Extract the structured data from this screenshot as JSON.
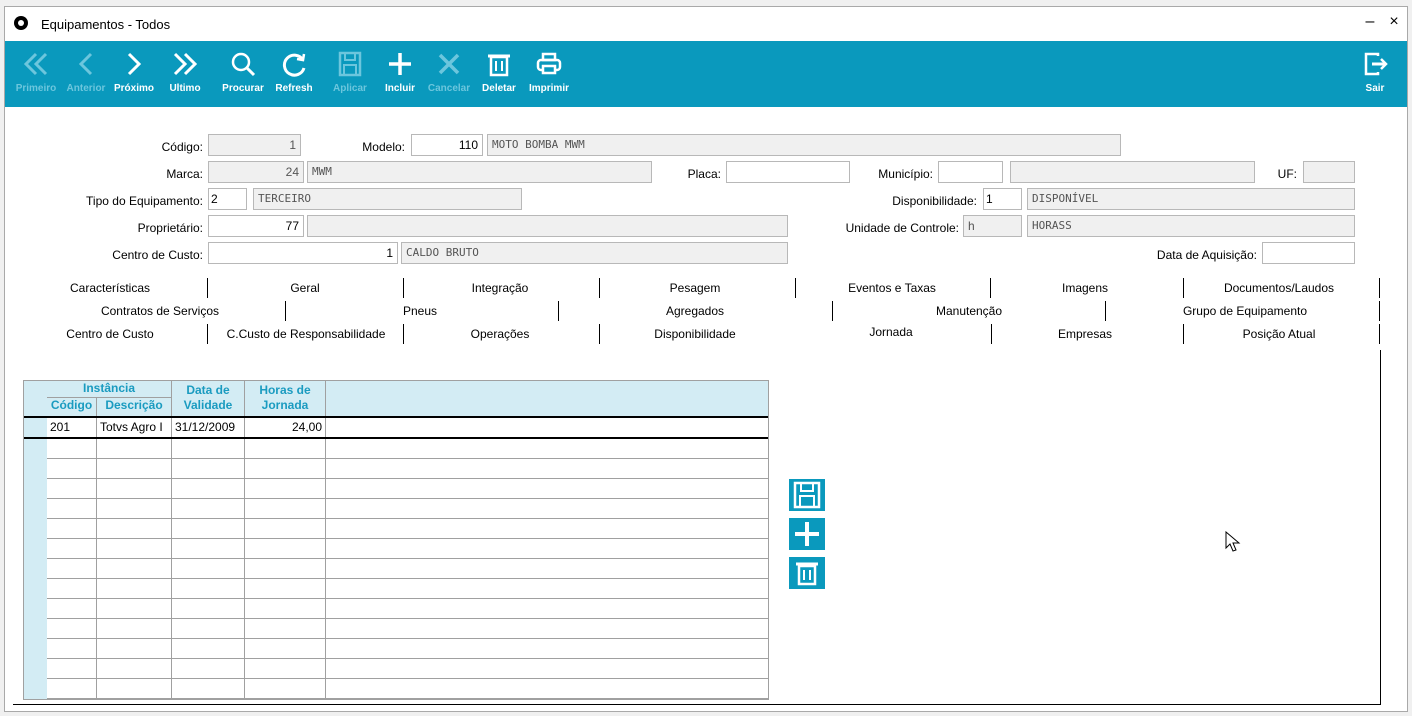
{
  "window": {
    "title": "Equipamentos - Todos",
    "minimize": "–",
    "close": "×"
  },
  "toolbar": {
    "primeiro": "Primeiro",
    "anterior": "Anterior",
    "proximo": "Próximo",
    "ultimo": "Ultimo",
    "procurar": "Procurar",
    "refresh": "Refresh",
    "aplicar": "Aplicar",
    "incluir": "Incluir",
    "cancelar": "Cancelar",
    "deletar": "Deletar",
    "imprimir": "Imprimir",
    "sair": "Sair"
  },
  "form": {
    "codigo_label": "Código:",
    "codigo": "1",
    "modelo_label": "Modelo:",
    "modelo_code": "110",
    "modelo_desc": "MOTO BOMBA MWM",
    "marca_label": "Marca:",
    "marca_code": "24",
    "marca_desc": "MWM",
    "placa_label": "Placa:",
    "placa": "",
    "municipio_label": "Município:",
    "municipio_code": "",
    "municipio_desc": "",
    "uf_label": "UF:",
    "uf": "",
    "tipo_label": "Tipo do Equipamento:",
    "tipo_code": "2",
    "tipo_desc": "TERCEIRO",
    "disp_label": "Disponibilidade:",
    "disp_code": "1",
    "disp_desc": "DISPONÍVEL",
    "prop_label": "Proprietário:",
    "prop_code": "77",
    "prop_desc": "",
    "unid_label": "Unidade de Controle:",
    "unid_code": "h",
    "unid_desc": "HORASS",
    "cc_label": "Centro de Custo:",
    "cc_code": "1",
    "cc_desc": "CALDO BRUTO",
    "aquis_label": "Data de Aquisição:",
    "aquis": ""
  },
  "tabs": {
    "row1": [
      "Características",
      "Geral",
      "Integração",
      "Pesagem",
      "Eventos e Taxas",
      "Imagens",
      "Documentos/Laudos"
    ],
    "row2": [
      "Contratos de Serviços",
      "Pneus",
      "Agregados",
      "Manutenção",
      "Grupo de Equipamento"
    ],
    "row3": [
      "Centro de Custo",
      "C.Custo de Responsabilidade",
      "Operações",
      "Disponibilidade",
      "Jornada",
      "Empresas",
      "Posição Atual"
    ],
    "active": "Jornada"
  },
  "grid": {
    "group_instancia": "Instância",
    "col_codigo": "Código",
    "col_descricao": "Descrição",
    "col_data_1": "Data de",
    "col_data_2": "Validade",
    "col_horas_1": "Horas de",
    "col_horas_2": "Jornada",
    "rows": [
      {
        "codigo": "201",
        "descricao": "Totvs Agro I",
        "data": "31/12/2009",
        "horas": "24,00"
      }
    ]
  },
  "colors": {
    "accent": "#0a99bd",
    "header_bg": "#d3ecf4",
    "header_text": "#1a9bc0"
  },
  "icons": [
    "first-icon",
    "prev-icon",
    "next-icon",
    "last-icon",
    "search-icon",
    "refresh-icon",
    "save-icon",
    "plus-icon",
    "cancel-icon",
    "trash-icon",
    "print-icon",
    "exit-icon"
  ]
}
